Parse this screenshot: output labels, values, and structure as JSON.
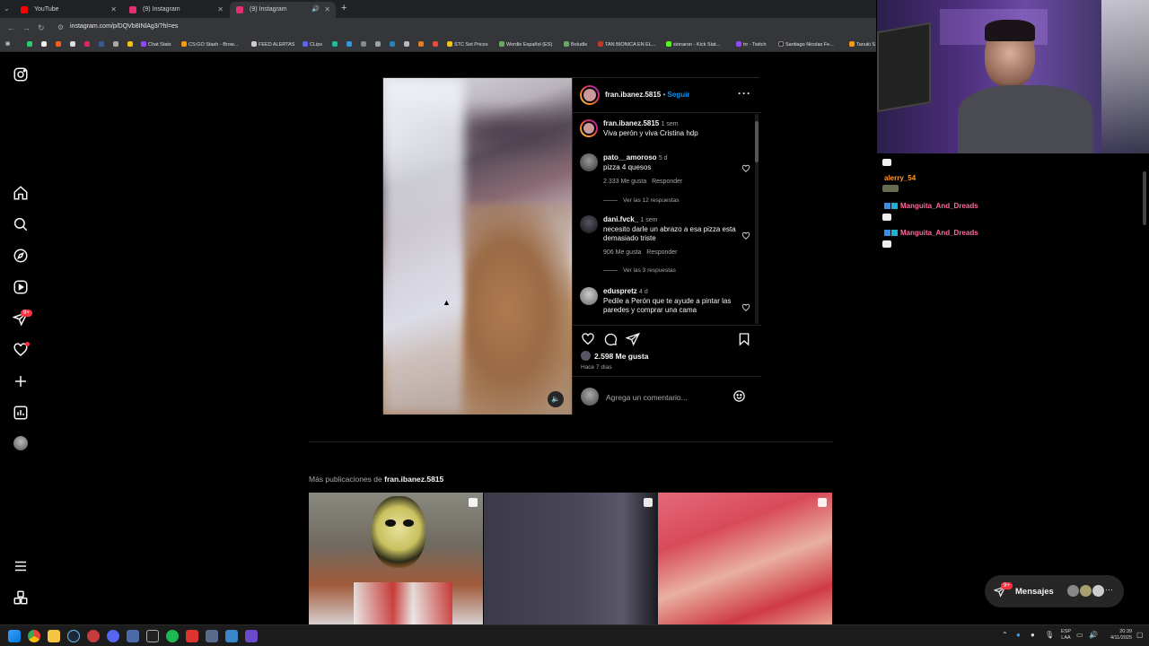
{
  "browser": {
    "tabs": [
      {
        "title": "YouTube",
        "color": "#ff0000"
      },
      {
        "title": "(9) Instagram",
        "color": "#e1306c"
      },
      {
        "title": "(9) Instagram",
        "color": "#e1306c"
      }
    ],
    "url": "instagram.com/p/DQVb8INlAg3/?hl=es",
    "bookmarks": [
      "Chat Stats",
      "CS:GO Stash - Brow...",
      "FEED ALERTAS",
      "CLips",
      "STC Set Prices",
      "Wordle Español (ES)",
      "Boludle",
      "TAN BIONICA EN EL...",
      "sionaron - Kick Stat...",
      "trr - Twitch",
      "Santiago Nicolas Fe...",
      "Tanuki S"
    ]
  },
  "sidebar": {
    "icons": [
      "instagram-logo-icon",
      "home-icon",
      "search-icon",
      "explore-icon",
      "reels-icon",
      "messages-icon",
      "notifications-icon",
      "create-icon",
      "dashboard-icon",
      "profile-avatar",
      "menu-icon",
      "also-from-meta-icon"
    ],
    "messages_badge": "9+"
  },
  "post": {
    "author": "fran.ibanez.5815",
    "separator": "•",
    "follow_label": "Seguir",
    "comments": [
      {
        "user": "fran.ibanez.5815",
        "time": "1 sem",
        "text": "Viva perón  y viva Cristina  hdp"
      },
      {
        "user": "pato__amoroso",
        "time": "5 d",
        "text": "pizza 4 quesos",
        "likes": "2.333 Me gusta",
        "reply": "Responder",
        "view_replies": "Ver las 12 respuestas"
      },
      {
        "user": "dani.fvck_",
        "time": "1 sem",
        "text": "necesito darle un abrazo a esa pizza esta demasiado triste",
        "likes": "906 Me gusta",
        "reply": "Responder",
        "view_replies": "Ver las 3 respuestas"
      },
      {
        "user": "eduspretz",
        "time": "4 d",
        "text": "Pedile a Perón que te ayude a pintar las paredes y comprar una cama"
      }
    ],
    "likes": "2.598 Me gusta",
    "posted": "Hace 7 días",
    "comment_placeholder": "Agrega un comentario..."
  },
  "more_posts": {
    "label_prefix": "Más publicaciones de",
    "label_user": "fran.ibanez.5815"
  },
  "stream_chat": {
    "lines": [
      {
        "user": "alerry_54",
        "color": "#ff9a2e"
      },
      {
        "user": "Manguita_And_Dreads",
        "color": "#ff6b9a"
      },
      {
        "user": "Manguita_And_Dreads",
        "color": "#ff6b9a"
      }
    ]
  },
  "messages_pill": {
    "label": "Mensajes",
    "badge": "9+"
  },
  "taskbar": {
    "lang": "ESP",
    "lang2": "LAA",
    "time": "20:39",
    "date": "4/11/2025"
  }
}
